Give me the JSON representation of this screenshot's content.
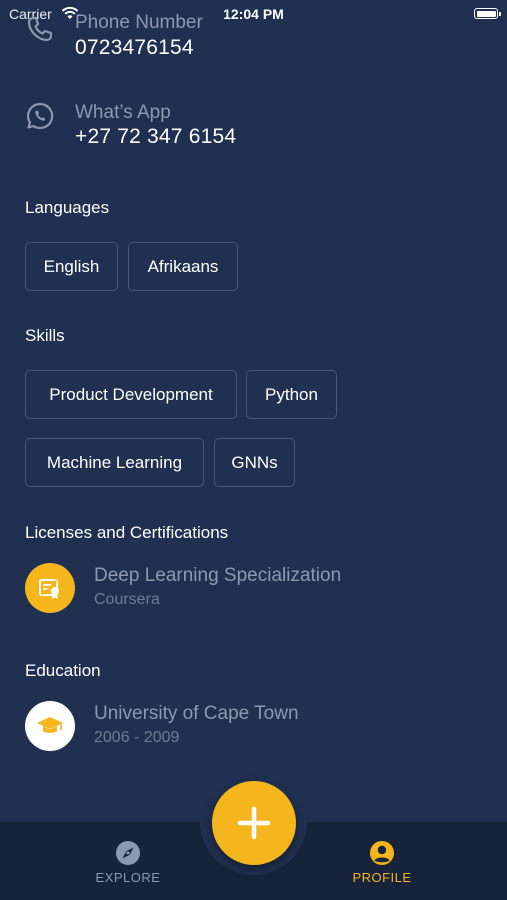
{
  "status_bar": {
    "carrier": "Carrier",
    "time": "12:04 PM"
  },
  "contact": {
    "phone": {
      "label": "Phone Number",
      "value": "0723476154"
    },
    "whatsapp": {
      "label": "What’s App",
      "value": "+27 72 347 6154"
    }
  },
  "languages": {
    "title": "Languages",
    "items": [
      "English",
      "Afrikaans"
    ]
  },
  "skills": {
    "title": "Skills",
    "items": [
      "Product Development",
      "Python",
      "Machine Learning",
      "GNNs"
    ]
  },
  "licenses": {
    "title": "Licenses and Certifications",
    "items": [
      {
        "name": "Deep Learning Specialization",
        "issuer": "Coursera"
      }
    ]
  },
  "education": {
    "title": "Education",
    "items": [
      {
        "school": "University of Cape Town",
        "years": "2006 - 2009"
      }
    ]
  },
  "nav": {
    "explore": "EXPLORE",
    "profile": "PROFILE",
    "active": "profile"
  },
  "colors": {
    "background": "#1f3050",
    "nav_background": "#16233a",
    "accent": "#f5b51c",
    "muted_text": "#8c9ab0"
  }
}
